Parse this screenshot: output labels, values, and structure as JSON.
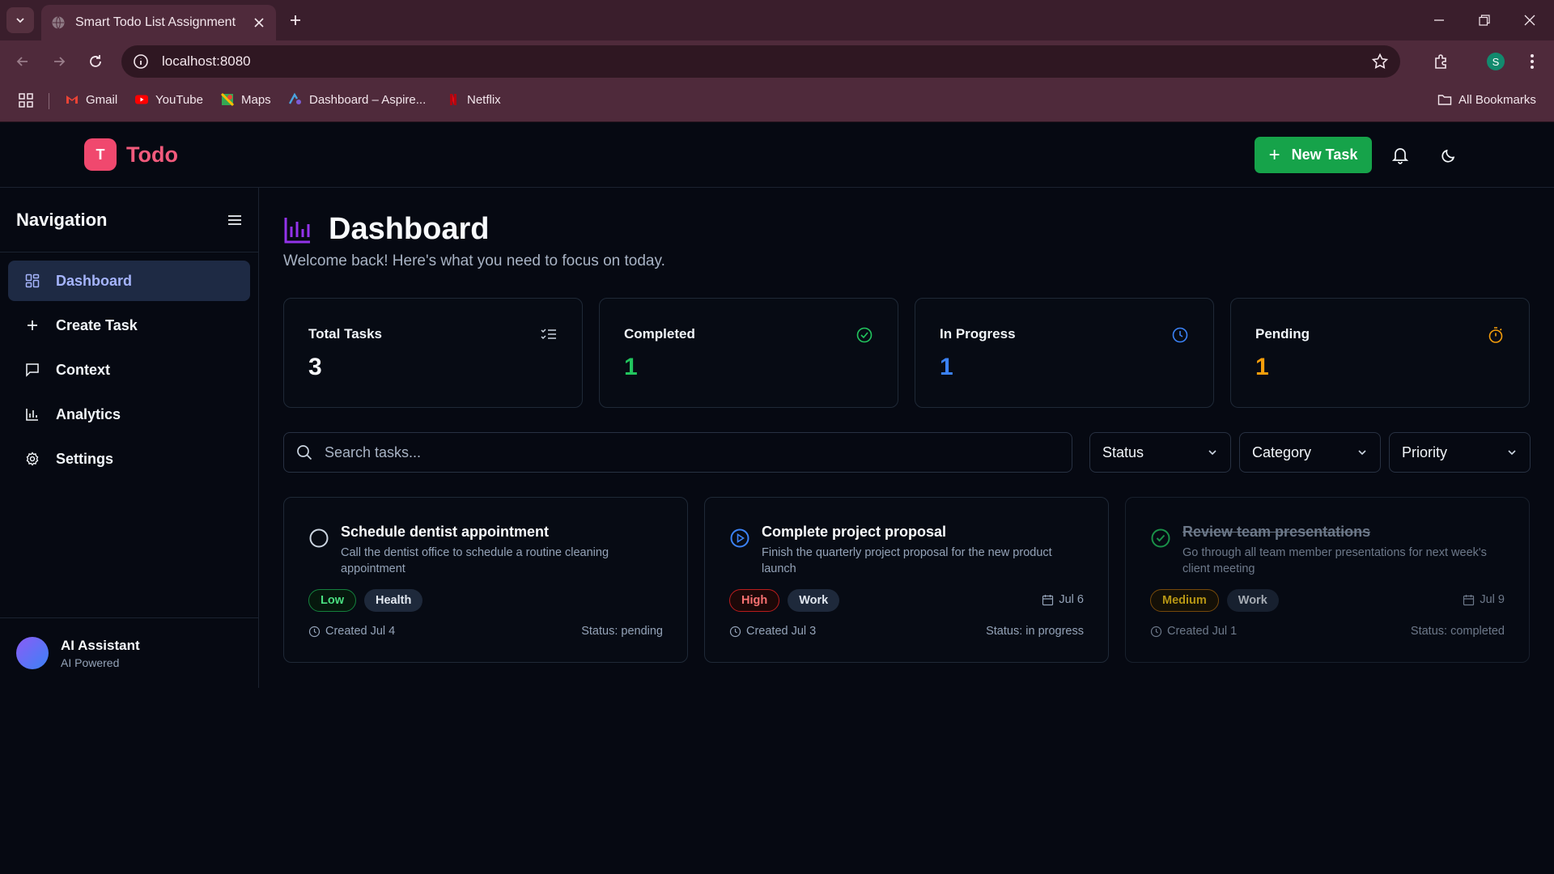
{
  "browser": {
    "tab_title": "Smart Todo List Assignment",
    "url": "localhost:8080",
    "profile_initial": "S",
    "bookmarks": [
      {
        "label": "Gmail",
        "icon": "gmail-icon"
      },
      {
        "label": "YouTube",
        "icon": "youtube-icon"
      },
      {
        "label": "Maps",
        "icon": "maps-icon"
      },
      {
        "label": "Dashboard – Aspire...",
        "icon": "aspire-icon"
      },
      {
        "label": "Netflix",
        "icon": "netflix-icon"
      }
    ],
    "all_bookmarks": "All Bookmarks"
  },
  "header": {
    "logo_letter": "T",
    "brand": "Todo",
    "new_task_label": "New Task"
  },
  "sidebar": {
    "title": "Navigation",
    "items": [
      {
        "label": "Dashboard",
        "icon": "grid-icon",
        "active": true
      },
      {
        "label": "Create Task",
        "icon": "plus-icon"
      },
      {
        "label": "Context",
        "icon": "message-icon"
      },
      {
        "label": "Analytics",
        "icon": "bar-chart-icon"
      },
      {
        "label": "Settings",
        "icon": "gear-icon"
      }
    ],
    "ai_name": "AI Assistant",
    "ai_sub": "AI Powered"
  },
  "main": {
    "title": "Dashboard",
    "subtitle": "Welcome back! Here's what you need to focus on today.",
    "stats": [
      {
        "label": "Total Tasks",
        "value": "3",
        "color": "#f8fafc",
        "icon": "list-check-icon"
      },
      {
        "label": "Completed",
        "value": "1",
        "color": "#22c55e",
        "icon": "check-circle-icon"
      },
      {
        "label": "In Progress",
        "value": "1",
        "color": "#3b82f6",
        "icon": "clock-icon"
      },
      {
        "label": "Pending",
        "value": "1",
        "color": "#f59e0b",
        "icon": "timer-icon"
      }
    ],
    "search_placeholder": "Search tasks...",
    "filters": [
      "Status",
      "Category",
      "Priority"
    ],
    "tasks": [
      {
        "title": "Schedule dentist appointment",
        "description": "Call the dentist office to schedule a routine cleaning appointment",
        "priority": "Low",
        "category": "Health",
        "due": "",
        "created": "Created Jul 4",
        "status": "Status: pending"
      },
      {
        "title": "Complete project proposal",
        "description": "Finish the quarterly project proposal for the new product launch",
        "priority": "High",
        "category": "Work",
        "due": "Jul 6",
        "created": "Created Jul 3",
        "status": "Status: in progress"
      },
      {
        "title": "Review team presentations",
        "description": "Go through all team member presentations for next week's client meeting",
        "priority": "Medium",
        "category": "Work",
        "due": "Jul 9",
        "created": "Created Jul 1",
        "status": "Status: completed"
      }
    ]
  }
}
